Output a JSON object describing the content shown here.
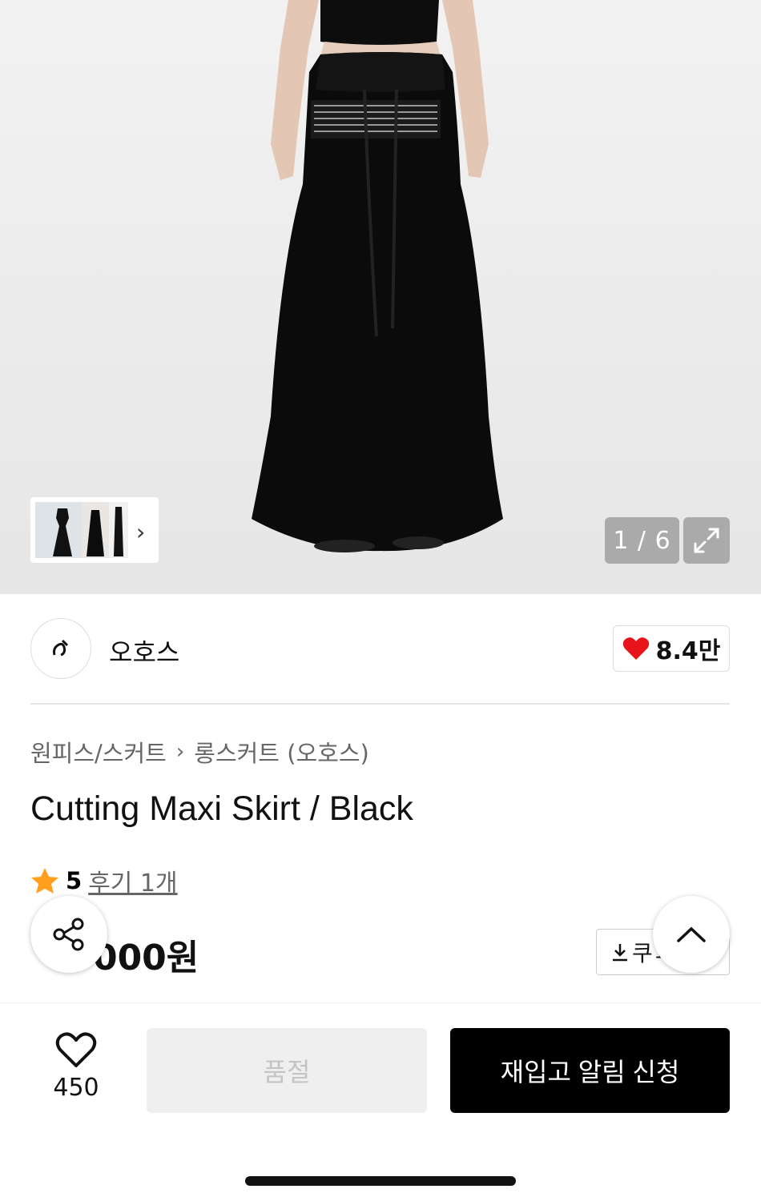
{
  "gallery": {
    "counter": "1 / 6",
    "thumb_count": 3
  },
  "brand": {
    "name": "오호스",
    "like_count": "8.4만"
  },
  "breadcrumb": {
    "category": "원피스/스커트",
    "subcategory": "롱스커트 (오호스)"
  },
  "product": {
    "title": "Cutting Maxi Skirt / Black",
    "rating": "5",
    "reviews_label": "후기 1개",
    "price_partial": "000원"
  },
  "coupon": {
    "label": "쿠ㅍ"
  },
  "bottom_bar": {
    "wish_count": "450",
    "soldout_label": "품절",
    "restock_label": "재입고 알림 신청"
  },
  "colors": {
    "heart": "#e8141b",
    "star": "#ff9f1c",
    "primary_button": "#000000"
  }
}
